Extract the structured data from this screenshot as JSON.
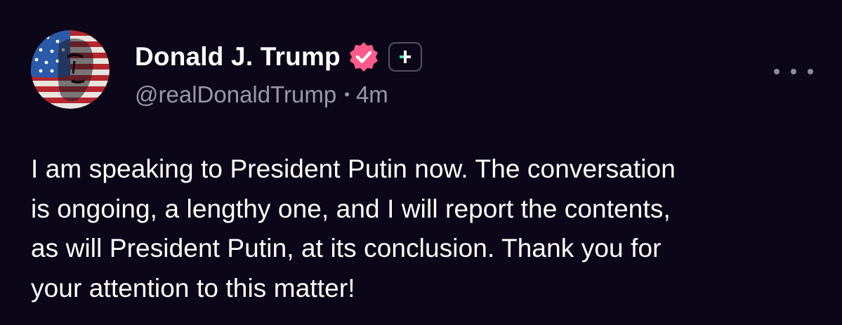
{
  "author": {
    "display_name": "Donald J. Trump",
    "handle": "@realDonaldTrump",
    "avatar": "american-flag-portrait",
    "verified_icon": "verified-check-badge-icon",
    "plus_icon": "plus-subscription-icon"
  },
  "meta": {
    "separator": "•",
    "time": "4m"
  },
  "post": {
    "lines": [
      "I am speaking to President Putin now. The conversation",
      "is ongoing, a lengthy one, and I will report the contents,",
      "as will President Putin, at its conclusion. Thank you for",
      "your attention to this matter!"
    ]
  },
  "menu": {
    "icon": "more-options-icon"
  },
  "colors": {
    "background": "#0b0718",
    "text": "#ffffff",
    "muted": "#9a98a6",
    "verified": "#ff5a8c",
    "plus_accent": "#3ee0b8"
  }
}
